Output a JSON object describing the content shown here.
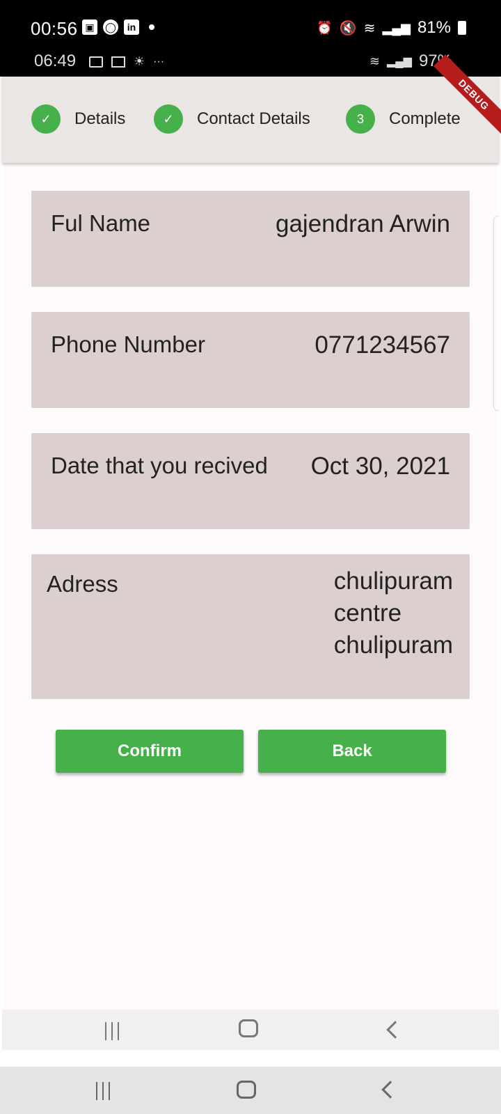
{
  "outer_status": {
    "time": "00:56",
    "battery": "81%"
  },
  "inner_status": {
    "time": "06:49",
    "ellipsis": "···",
    "battery": "97%"
  },
  "app": {
    "debug_label": "DEBUG",
    "steps": [
      {
        "label": "Details",
        "state": "done",
        "marker": "✓"
      },
      {
        "label": "Contact Details",
        "state": "done",
        "marker": "✓"
      },
      {
        "label": "Complete",
        "state": "active",
        "marker": "3"
      }
    ],
    "fields": [
      {
        "label": "Ful Name",
        "value": "gajendran Arwin"
      },
      {
        "label": "Phone Number",
        "value": "0771234567"
      },
      {
        "label": "Date that you recived",
        "value": "Oct 30, 2021"
      },
      {
        "label": "Adress",
        "value_lines": [
          "chulipuram",
          "centre",
          "chulipuram"
        ]
      }
    ],
    "buttons": {
      "confirm": "Confirm",
      "back": "Back"
    }
  },
  "colors": {
    "accent_green": "#46b04b",
    "card_bg": "#dbd0cf",
    "stepper_bg": "#e9e6e4",
    "debug_red": "#b71c1c"
  }
}
